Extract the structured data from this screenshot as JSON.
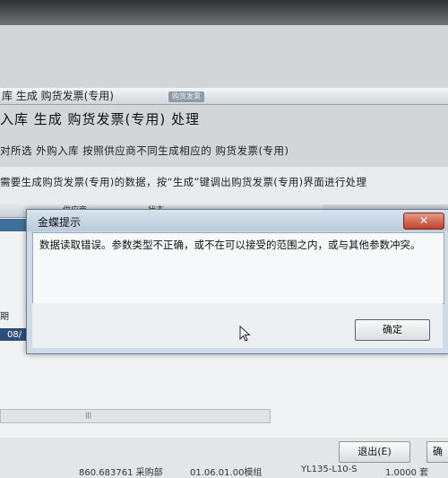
{
  "window": {
    "title": "库 生成 购货发票(专用)",
    "tab_label": "购货发票"
  },
  "page": {
    "heading": "入库 生成 购货发票(专用) 处理",
    "subline": "对所选  外购入库  按照供应商不同生成相应的  购货发票(专用)",
    "note": "需要生成购货发票(专用)的数据，按“生成”键调出购货发票(专用)界面进行处理"
  },
  "grid": {
    "columns": [
      "供应商",
      "状态"
    ],
    "row_label": "期",
    "row_value": "08/"
  },
  "dialog": {
    "title": "金蝶提示",
    "close_label": "✕",
    "message": "数据读取错误。参数类型不正确，或不在可以接受的范围之内，或与其他参数冲突。",
    "ok_label": "确定"
  },
  "footer": {
    "exit_label": "退出(E)",
    "confirm_label": "确",
    "bottom_row": [
      "860.683761 采购部",
      "01.06.01.00模组",
      "YL135-L10-S",
      "1.0000 套"
    ]
  },
  "colors": {
    "dialog_bg": "#cfdbe6",
    "close_red": "#c1402b",
    "selected_row": "#3e6e9a"
  }
}
